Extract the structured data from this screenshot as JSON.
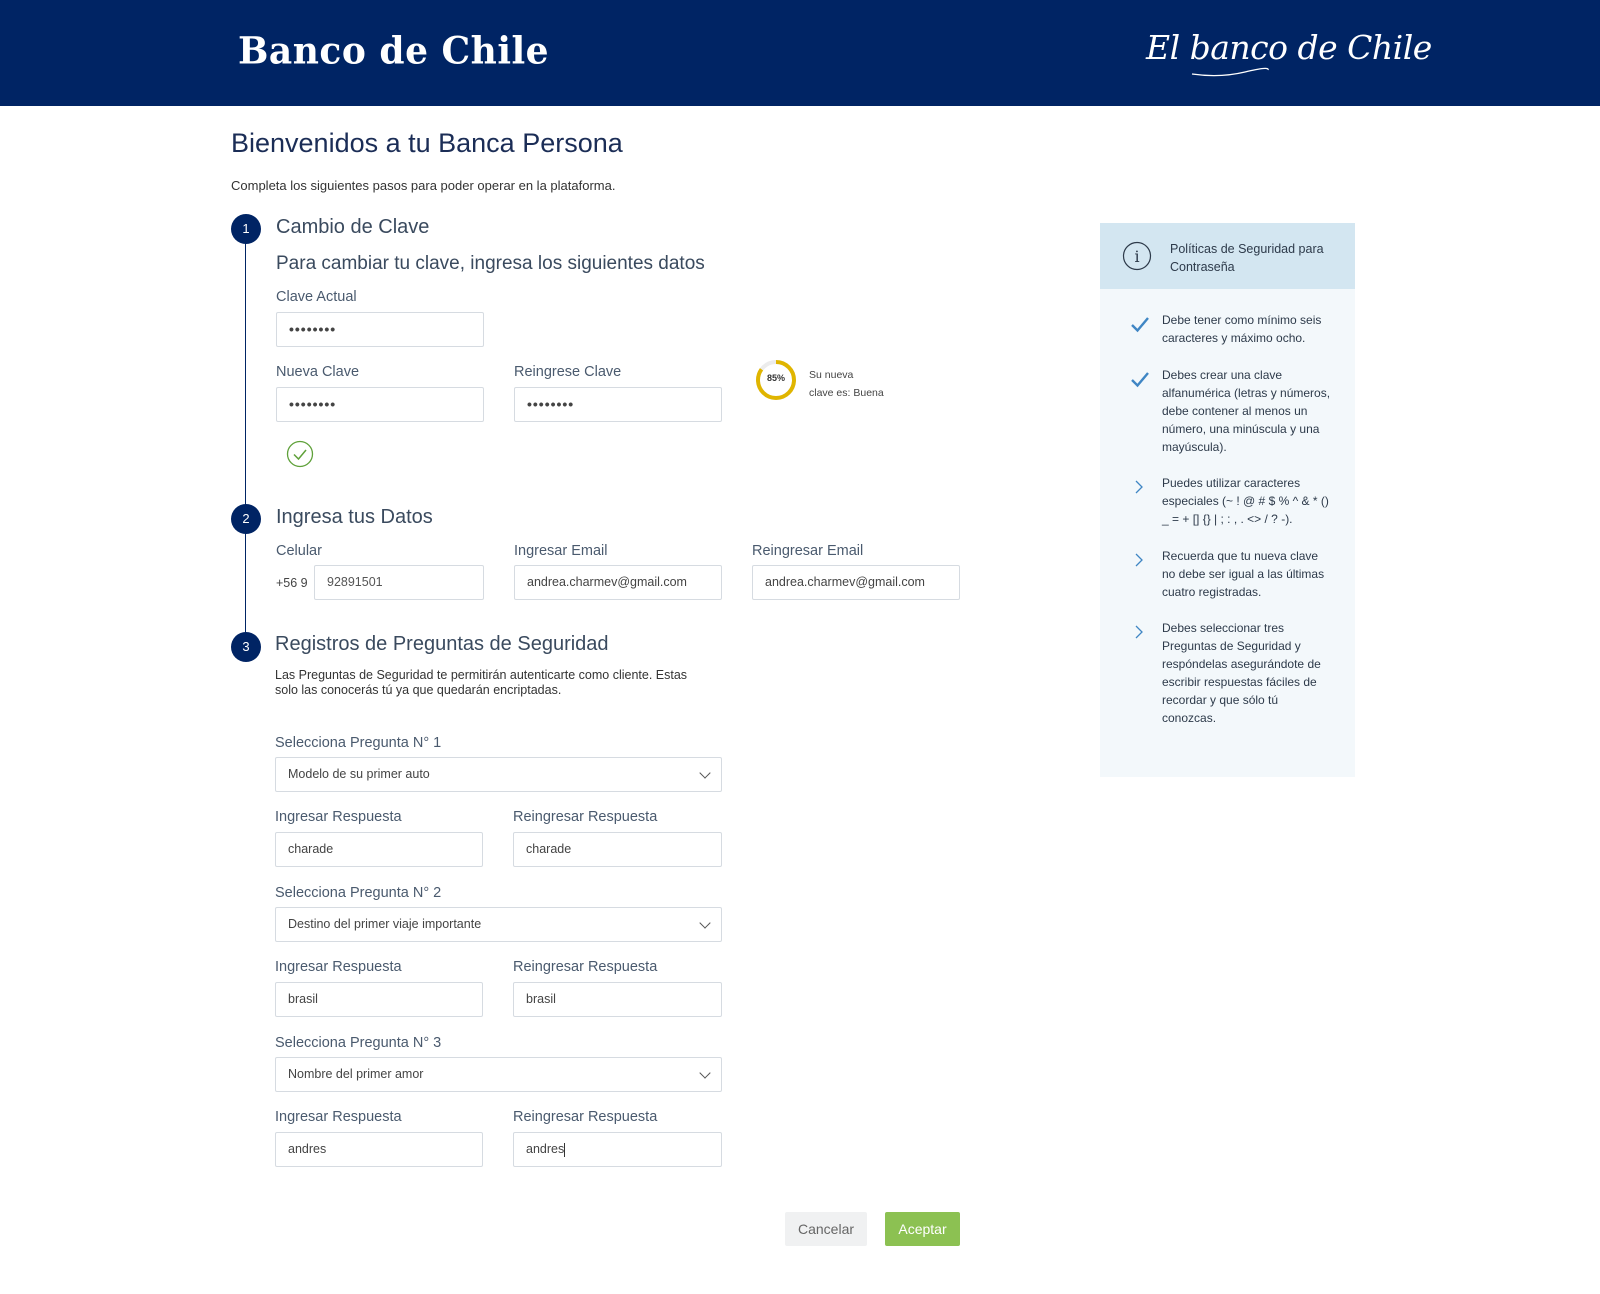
{
  "header": {
    "logo": "Banco de Chile",
    "tagline": "El banco de Chile"
  },
  "page": {
    "title": "Bienvenidos a tu Banca Persona",
    "subtitle": "Completa los siguientes pasos para poder operar en la plataforma."
  },
  "step1": {
    "number": "1",
    "title": "Cambio de Clave",
    "subtitle": "Para cambiar tu clave, ingresa los siguientes datos",
    "current_label": "Clave Actual",
    "current_value": "••••••••",
    "new_label": "Nueva Clave",
    "new_value": "••••••••",
    "repeat_label": "Reingrese Clave",
    "repeat_value": "••••••••",
    "strength_pct": "85%",
    "strength_fraction": 0.85,
    "strength_line1": "Su nueva",
    "strength_line2": "clave es: Buena",
    "colors": {
      "strength": "#e0b500",
      "ok_check": "#5fa13a"
    }
  },
  "step2": {
    "number": "2",
    "title": "Ingresa tus Datos",
    "phone_label": "Celular",
    "phone_prefix": "+56 9",
    "phone_value": "92891501",
    "email_label": "Ingresar Email",
    "email_value": "andrea.charmev@gmail.com",
    "email2_label": "Reingresar Email",
    "email2_value": "andrea.charmev@gmail.com"
  },
  "step3": {
    "number": "3",
    "title": "Registros de Preguntas de Seguridad",
    "desc_line1": "Las Preguntas de Seguridad te permitirán autenticarte como cliente. Estas",
    "desc_line2": "solo las conocerás tú ya que quedarán encriptadas.",
    "questions": [
      {
        "label": "Selecciona Pregunta N° 1",
        "selected": "Modelo de su primer auto",
        "answer_label": "Ingresar Respuesta",
        "answer": "charade",
        "reanswer_label": "Reingresar Respuesta",
        "reanswer": "charade"
      },
      {
        "label": "Selecciona Pregunta N° 2",
        "selected": "Destino del primer viaje importante",
        "answer_label": "Ingresar Respuesta",
        "answer": "brasil",
        "reanswer_label": "Reingresar Respuesta",
        "reanswer": "brasil"
      },
      {
        "label": "Selecciona Pregunta N° 3",
        "selected": "Nombre del primer amor",
        "answer_label": "Ingresar Respuesta",
        "answer": "andres",
        "reanswer_label": "Reingresar Respuesta",
        "reanswer": "andres"
      }
    ]
  },
  "buttons": {
    "cancel": "Cancelar",
    "accept": "Aceptar"
  },
  "sidebar": {
    "title_line1": "Políticas de Seguridad para",
    "title_line2": "Contraseña",
    "rules": [
      {
        "icon": "check-icon",
        "lines": [
          "Debe tener como mínimo seis",
          "caracteres y máximo ocho."
        ]
      },
      {
        "icon": "check-icon",
        "lines": [
          "Debes crear una clave",
          "alfanumérica (letras y números,",
          "debe contener al menos un",
          "número, una minúscula y una",
          "mayúscula)."
        ]
      },
      {
        "icon": "chevron-right-icon",
        "lines": [
          "Puedes utilizar caracteres",
          "especiales (~ ! @ # $ % ^ & * ()",
          "_ = + [] {} | ; : , . <> / ? -)."
        ]
      },
      {
        "icon": "chevron-right-icon",
        "lines": [
          "Recuerda que tu nueva clave",
          "no debe ser igual a las últimas",
          "cuatro registradas."
        ]
      },
      {
        "icon": "chevron-right-icon",
        "lines": [
          "Debes seleccionar tres",
          "Preguntas de Seguridad y",
          "respóndelas asegurándote de",
          "escribir respuestas fáciles de",
          "recordar y que sólo tú",
          "conozcas."
        ]
      }
    ]
  },
  "colors": {
    "brand": "#002464",
    "accept": "#8cc152",
    "sidebar_head": "#d3e6f1",
    "sidebar_bg": "#f3f8fb",
    "rule_icon": "#3f86c4"
  }
}
